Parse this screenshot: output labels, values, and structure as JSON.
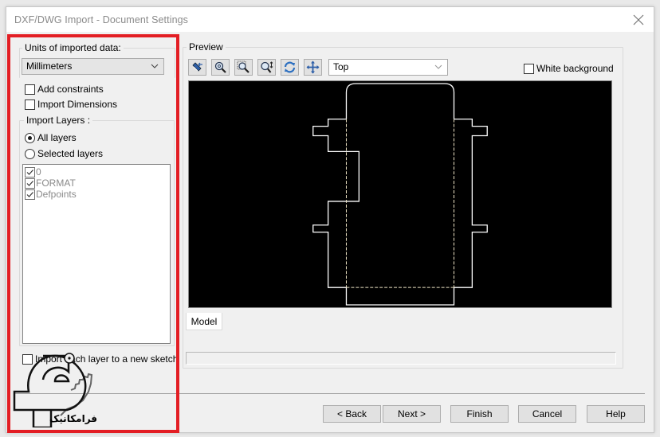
{
  "window": {
    "title": "DXF/DWG Import - Document Settings"
  },
  "left_panel": {
    "units_label": "Units of imported data:",
    "units_value": "Millimeters",
    "add_constraints": {
      "label": "Add constraints",
      "checked": false
    },
    "import_dimensions": {
      "label": "Import Dimensions",
      "checked": false
    },
    "import_layers": {
      "label": "Import Layers :",
      "options": [
        {
          "label": "All layers",
          "selected": true
        },
        {
          "label": "Selected layers",
          "selected": false
        }
      ],
      "layers": [
        {
          "name": "0",
          "checked": true
        },
        {
          "name": "FORMAT",
          "checked": true
        },
        {
          "name": "Defpoints",
          "checked": true
        }
      ]
    },
    "import_each_layer": {
      "label": "Import each layer to a new sketch",
      "checked": false
    }
  },
  "preview": {
    "label": "Preview",
    "tools": [
      {
        "name": "select-tool",
        "tooltip": "Select"
      },
      {
        "name": "zoom-in-tool",
        "tooltip": "Zoom"
      },
      {
        "name": "zoom-window-tool",
        "tooltip": "Zoom to area"
      },
      {
        "name": "zoom-fit-tool",
        "tooltip": "Zoom in/out"
      },
      {
        "name": "rotate-tool",
        "tooltip": "Rotate"
      },
      {
        "name": "pan-tool",
        "tooltip": "Pan"
      }
    ],
    "view_value": "Top",
    "white_background": {
      "label": "White background",
      "checked": false
    },
    "background_color": "#000000",
    "line_color": "#ffffff",
    "hidden_line_color": "#f0e6c8",
    "tab_label": "Model"
  },
  "buttons": {
    "back": "< Back",
    "next": "Next >",
    "finish": "Finish",
    "cancel": "Cancel",
    "help": "Help"
  },
  "watermark": {
    "text": "فرامکانیک"
  },
  "colors": {
    "highlight_frame": "#e31e24",
    "dialog_bg": "#f0f0f0"
  }
}
